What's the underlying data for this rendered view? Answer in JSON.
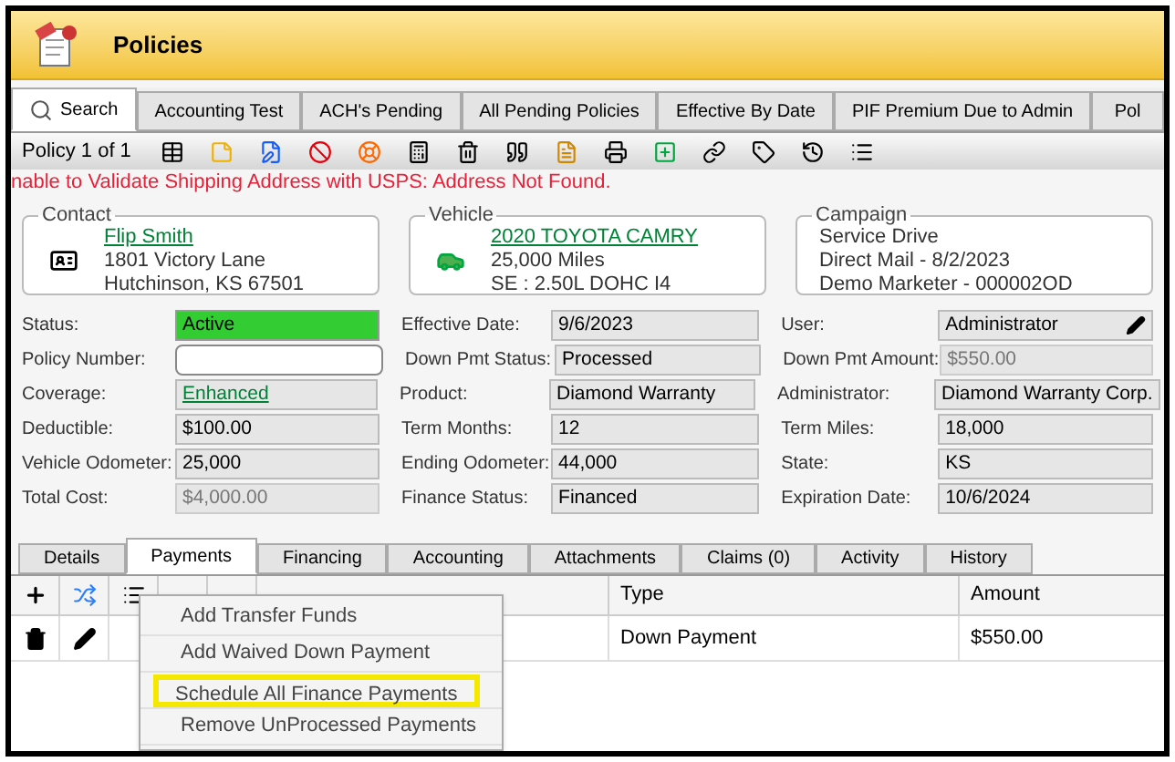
{
  "window": {
    "title": "Policies"
  },
  "tabs": [
    {
      "label": "Search",
      "kind": "search",
      "selected": true
    },
    {
      "label": "Accounting Test",
      "kind": "plain",
      "selected": false
    },
    {
      "label": "ACH's Pending",
      "kind": "plain",
      "selected": false
    },
    {
      "label": "All Pending Policies",
      "kind": "plain",
      "selected": false
    },
    {
      "label": "Effective By Date",
      "kind": "plain",
      "selected": false
    },
    {
      "label": "PIF Premium Due to Admin",
      "kind": "plain",
      "selected": false
    },
    {
      "label": "Pol",
      "kind": "plain",
      "selected": false
    }
  ],
  "toolbar": {
    "record": "Policy 1 of 1"
  },
  "error": "nable to Validate Shipping Address with USPS: Address Not Found.",
  "groups": [
    {
      "title": "Contact",
      "kind": "contact",
      "lines": [
        "Flip Smith",
        "1801 Victory Lane",
        "Hutchinson, KS 67501"
      ]
    },
    {
      "title": "Vehicle",
      "kind": "vehicle",
      "lines": [
        "2020 TOYOTA CAMRY",
        "25,000 Miles",
        "SE : 2.50L DOHC I4"
      ]
    },
    {
      "title": "Campaign",
      "kind": "campaign",
      "lines": [
        "Service Drive",
        "Direct Mail - 8/2/2023",
        "Demo Marketer - 000002OD"
      ]
    }
  ],
  "fields": [
    [
      {
        "label": "Status:",
        "value": "Active",
        "kind": "status"
      },
      {
        "label": "Effective Date:",
        "value": "9/6/2023",
        "kind": "readonly"
      },
      {
        "label": "User:",
        "value": "Administrator",
        "kind": "editable"
      }
    ],
    [
      {
        "label": "Policy Number:",
        "kind": "input"
      },
      {
        "label": "Down Pmt Status:",
        "value": "Processed",
        "kind": "readonly"
      },
      {
        "label": "Down Pmt Amount:",
        "value": "$550.00",
        "kind": "disabled"
      }
    ],
    [
      {
        "label": "Coverage:",
        "value": "Enhanced",
        "kind": "link"
      },
      {
        "label": "Product:",
        "value": "Diamond Warranty",
        "kind": "readonly"
      },
      {
        "label": "Administrator:",
        "value": "Diamond Warranty Corp.",
        "kind": "readonly"
      }
    ],
    [
      {
        "label": "Deductible:",
        "value": "$100.00",
        "kind": "readonly"
      },
      {
        "label": "Term Months:",
        "value": "12",
        "kind": "readonly"
      },
      {
        "label": "Term Miles:",
        "value": "18,000",
        "kind": "readonly"
      }
    ],
    [
      {
        "label": "Vehicle Odometer:",
        "value": "25,000",
        "kind": "readonly"
      },
      {
        "label": "Ending Odometer:",
        "value": "44,000",
        "kind": "readonly"
      },
      {
        "label": "State:",
        "value": "KS",
        "kind": "readonly"
      }
    ],
    [
      {
        "label": "Total Cost:",
        "value": "$4,000.00",
        "kind": "disabled"
      },
      {
        "label": "Finance Status:",
        "value": "Financed",
        "kind": "readonly"
      },
      {
        "label": "Expiration Date:",
        "value": "10/6/2024",
        "kind": "readonly"
      }
    ]
  ],
  "detail_tabs": [
    {
      "label": "Details",
      "selected": false
    },
    {
      "label": "Payments",
      "selected": true
    },
    {
      "label": "Financing",
      "selected": false
    },
    {
      "label": "Accounting",
      "selected": false
    },
    {
      "label": "Attachments",
      "selected": false
    },
    {
      "label": "Claims (0)",
      "selected": false
    },
    {
      "label": "Activity",
      "selected": false
    },
    {
      "label": "History",
      "selected": false
    }
  ],
  "grid": {
    "columns": [
      "Type",
      "Amount"
    ],
    "rows": [
      {
        "type": "Down Payment",
        "amount": "$550.00"
      }
    ]
  },
  "menu": [
    {
      "label": "Add Transfer Funds",
      "selected": false
    },
    {
      "label": "Add Waived Down Payment",
      "selected": false
    },
    {
      "label": "Schedule All Finance Payments",
      "selected": true
    },
    {
      "label": "Remove UnProcessed Payments",
      "selected": false
    }
  ]
}
